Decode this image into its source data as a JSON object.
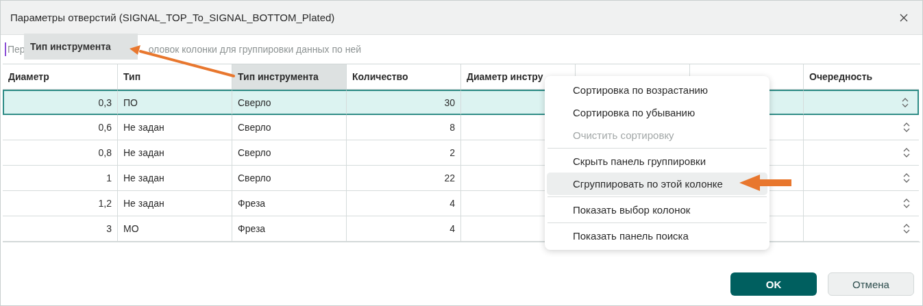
{
  "window": {
    "title": "Параметры отверстий (SIGNAL_TOP_To_SIGNAL_BOTTOM_Plated)"
  },
  "group_panel": {
    "hint_start": "Пер",
    "hint_end": "оловок колонки для группировки данных по ней",
    "drag_label": "Тип инструмента"
  },
  "table": {
    "columns": [
      {
        "label": "Диаметр",
        "selected": false
      },
      {
        "label": "Тип",
        "selected": false
      },
      {
        "label": "Тип инструмента",
        "selected": true
      },
      {
        "label": "Количество",
        "selected": false
      },
      {
        "label": "Диаметр инстру",
        "selected": false
      },
      {
        "selected": false
      },
      {
        "selected": false
      },
      {
        "label": "Очередность",
        "selected": false
      }
    ],
    "rows": [
      {
        "selected": true,
        "cells": [
          "0,3",
          "ПО",
          "Сверло",
          "30"
        ]
      },
      {
        "selected": false,
        "cells": [
          "0,6",
          "Не задан",
          "Сверло",
          "8"
        ]
      },
      {
        "selected": false,
        "cells": [
          "0,8",
          "Не задан",
          "Сверло",
          "2"
        ]
      },
      {
        "selected": false,
        "cells": [
          "1",
          "Не задан",
          "Сверло",
          "22"
        ]
      },
      {
        "selected": false,
        "cells": [
          "1,2",
          "Не задан",
          "Фреза",
          "4"
        ]
      },
      {
        "selected": false,
        "cells": [
          "3",
          "МО",
          "Фреза",
          "4"
        ]
      }
    ]
  },
  "context_menu": [
    {
      "kind": "item",
      "label": "Сортировка по возрастанию",
      "disabled": false,
      "selected": false
    },
    {
      "kind": "item",
      "label": "Сортировка по убыванию",
      "disabled": false,
      "selected": false
    },
    {
      "kind": "item",
      "label": "Очистить сортировку",
      "disabled": true,
      "selected": false
    },
    {
      "kind": "separator"
    },
    {
      "kind": "item",
      "label": "Скрыть панель группировки",
      "disabled": false,
      "selected": false
    },
    {
      "kind": "item",
      "label": "Сгруппировать по этой колонке",
      "disabled": false,
      "selected": true
    },
    {
      "kind": "separator"
    },
    {
      "kind": "item",
      "label": "Показать выбор колонок",
      "disabled": false,
      "selected": false
    },
    {
      "kind": "separator"
    },
    {
      "kind": "item",
      "label": "Показать панель поиска",
      "disabled": false,
      "selected": false
    }
  ],
  "buttons": [
    {
      "label": "OK",
      "kind": "primary"
    },
    {
      "label": "Отмена",
      "kind": "secondary"
    }
  ]
}
